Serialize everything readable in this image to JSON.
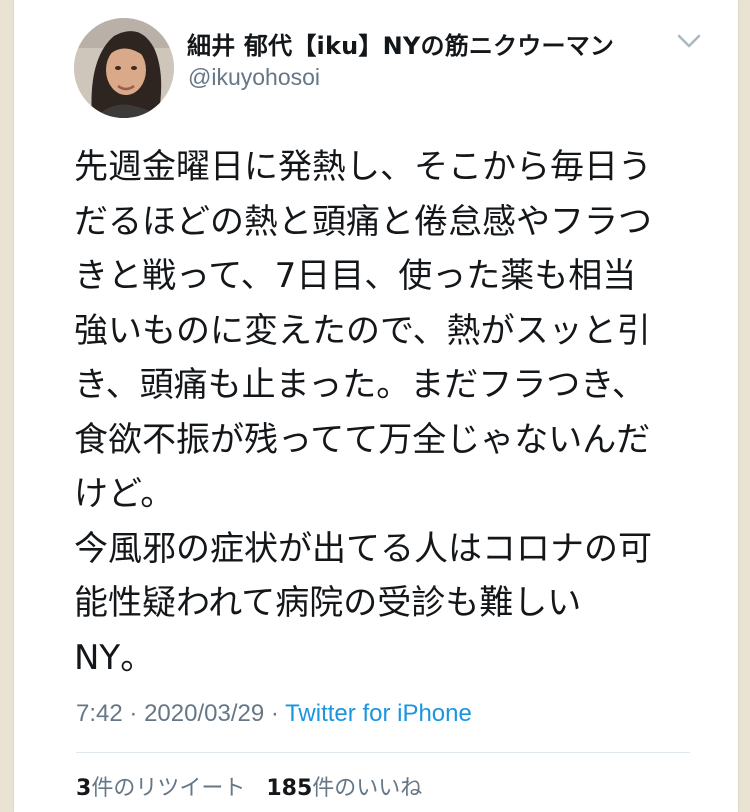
{
  "tweet": {
    "author": {
      "display_name": "細井 郁代【iku】NYの筋ニクウーマン",
      "handle": "@ikuyohosoi"
    },
    "body_lines": [
      "先週金曜日に発熱し、そこから毎日う",
      "だるほどの熱と頭痛と倦怠感やフラつ",
      "きと戦って、7日目、使った薬も相当",
      "強いものに変えたので、熱がスッと引",
      "き、頭痛も止まった。まだフラつき、",
      "食欲不振が残ってて万全じゃないんだ",
      "けど。",
      "今風邪の症状が出てる人はコロナの可",
      "能性疑われて病院の受診も難しい",
      "NY。"
    ],
    "time": "7:42",
    "date": "2020/03/29",
    "separator": "·",
    "source": "Twitter for iPhone",
    "retweets": {
      "count": "3",
      "label": "件のリツイート"
    },
    "likes": {
      "count": "185",
      "label": "件のいいね"
    }
  },
  "icons": {
    "menu": "chevron-down-icon",
    "avatar": "avatar"
  },
  "colors": {
    "text": "#14171a",
    "secondary": "#657786",
    "link": "#1b95e0",
    "background": "#e9e3d3"
  }
}
